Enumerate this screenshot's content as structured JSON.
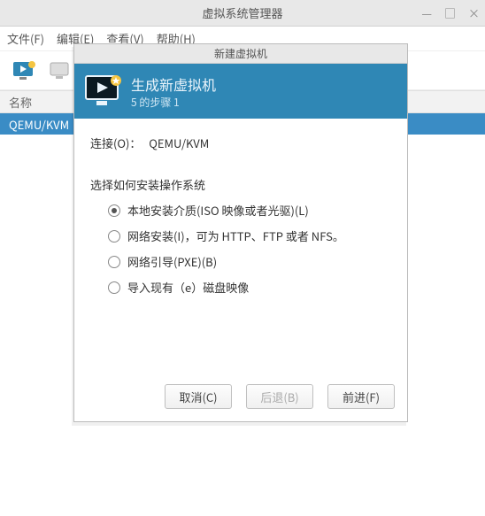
{
  "window": {
    "title": "虚拟系统管理器",
    "controls": {
      "min": "—",
      "max": "□",
      "close": "×"
    }
  },
  "menubar": {
    "file": "文件(F)",
    "edit": "编辑(E)",
    "view": "查看(V)",
    "help": "帮助(H)"
  },
  "list": {
    "header": "名称",
    "row0": "QEMU/KVM"
  },
  "dialog": {
    "title": "新建虚拟机",
    "header_title": "生成新虚拟机",
    "step": "5 的步骤 1",
    "connection_label": "连接(O)：",
    "connection_value": "QEMU/KVM",
    "section_label": "选择如何安装操作系统",
    "options": {
      "local": "本地安装介质(ISO 映像或者光驱)(L)",
      "network": "网络安装(I)，可为 HTTP、FTP 或者 NFS。",
      "pxe": "网络引导(PXE)(B)",
      "import": "导入现有（e）磁盘映像"
    },
    "buttons": {
      "cancel": "取消(C)",
      "back": "后退(B)",
      "forward": "前进(F)"
    }
  }
}
